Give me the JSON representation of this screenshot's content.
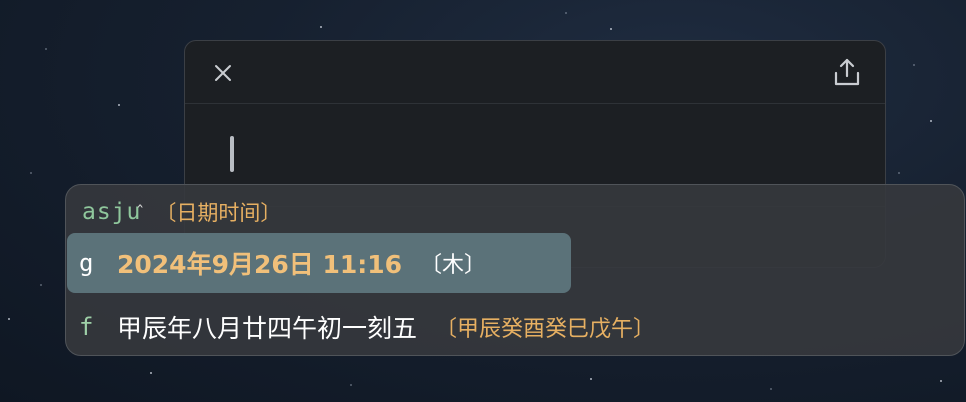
{
  "editor": {
    "close_icon": "close-icon",
    "share_icon": "share-icon"
  },
  "ime": {
    "preedit_code": "asju",
    "preedit_comment": "〔日期时间〕",
    "candidates": [
      {
        "key": "g",
        "text": "2024年9月26日 11:16",
        "comment": "〔木〕",
        "selected": true
      },
      {
        "key": "f",
        "text": "甲辰年八月廿四午初一刻五",
        "comment": "〔甲辰癸酉癸巳戊午〕",
        "selected": false
      }
    ]
  },
  "colors": {
    "preedit_code": "#8fc79c",
    "comment": "#e7b062",
    "selected_text": "#f1c07a",
    "selected_bg": "#5b7279",
    "panel_bg": "#36393d",
    "editor_bg": "#1c1f23"
  }
}
